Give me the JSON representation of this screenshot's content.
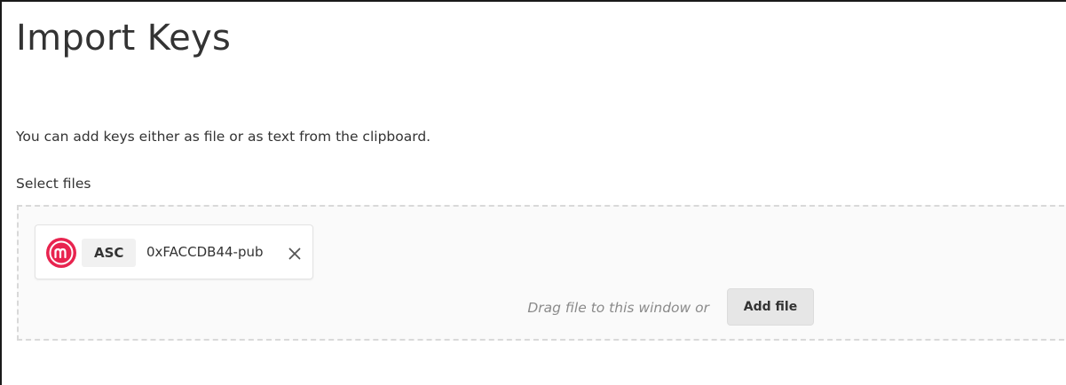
{
  "page": {
    "title": "Import Keys",
    "intro": "You can add keys either as file or as text from the clipboard.",
    "select_files_label": "Select files"
  },
  "dropzone": {
    "files": [
      {
        "icon": "app-logo-icon",
        "type": "ASC",
        "name": "0xFACCDB44-pub",
        "remove_icon": "close-icon"
      }
    ],
    "drag_hint": "Drag file to this window or",
    "add_file_label": "Add file"
  },
  "colors": {
    "logo": "#e8244f",
    "text": "#333333",
    "hint": "#8a8a8a",
    "dropzone_border": "#d9d9d9",
    "button_bg": "#e6e6e6"
  }
}
